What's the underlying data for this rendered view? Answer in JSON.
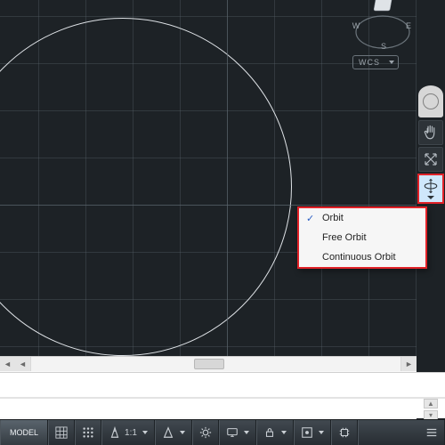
{
  "viewport": {
    "compass_label_s": "S",
    "compass_label_e": "E",
    "compass_label_w": "W",
    "wcs_label": "WCS"
  },
  "nav": {
    "tools": {
      "wheel": "steering-wheel",
      "pan": "pan",
      "zoom": "zoom-extents",
      "orbit": "orbit"
    }
  },
  "orbit_menu": {
    "items": [
      {
        "label": "Orbit",
        "checked": true
      },
      {
        "label": "Free Orbit",
        "checked": false
      },
      {
        "label": "Continuous Orbit",
        "checked": false
      }
    ]
  },
  "status": {
    "model_tab": "MODEL",
    "grid": "grid",
    "scale_label": "1:1",
    "annotation": "annotation"
  },
  "cmd": {
    "prompt": ""
  }
}
